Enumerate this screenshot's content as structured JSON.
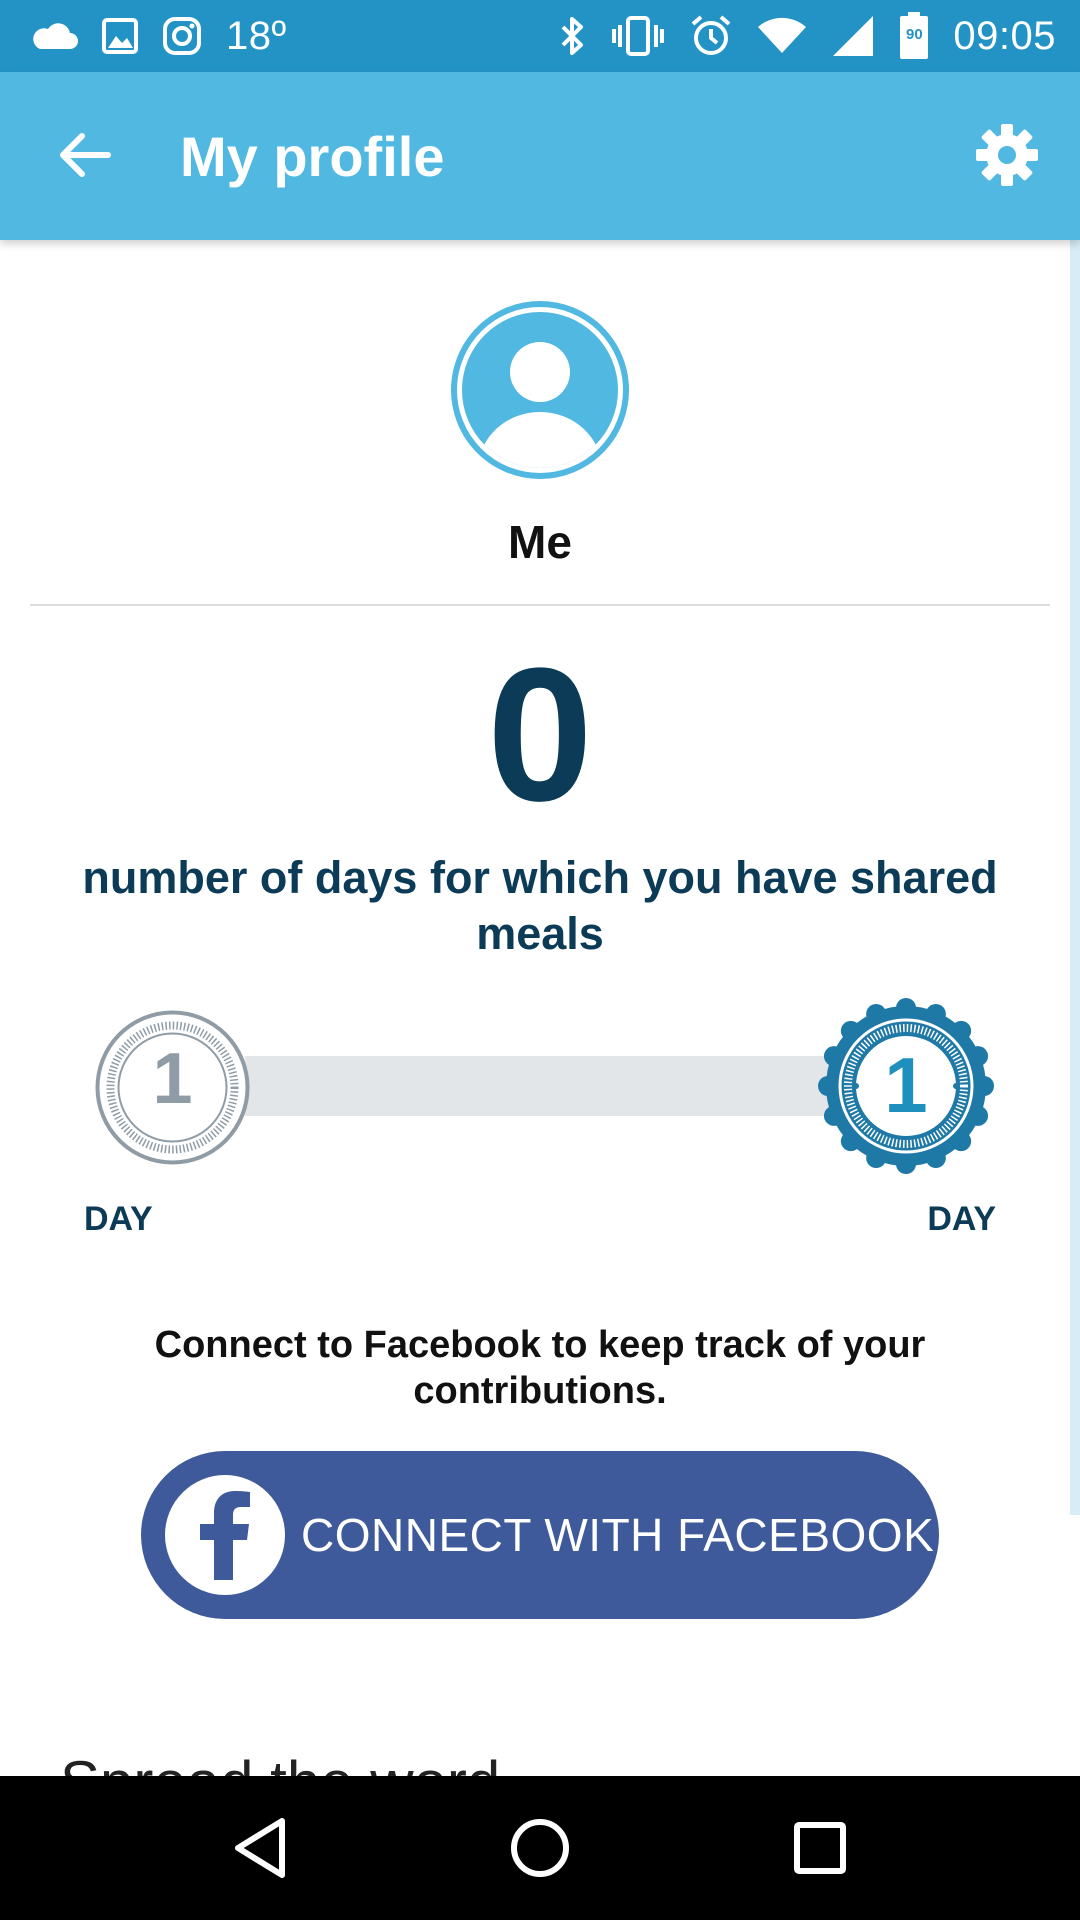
{
  "status_bar": {
    "temperature": "18º",
    "battery_level": "90",
    "time": "09:05",
    "icons": [
      "cloud-icon",
      "image-icon",
      "instagram-icon",
      "bluetooth-icon",
      "vibrate-icon",
      "alarm-icon",
      "wifi-icon",
      "signal-icon",
      "battery-icon"
    ]
  },
  "app_bar": {
    "title": "My profile",
    "back_icon": "arrow-left-icon",
    "settings_icon": "gear-icon"
  },
  "profile": {
    "name": "Me",
    "avatar_icon": "user-avatar-icon"
  },
  "stats": {
    "days_count": "0",
    "caption": "number of days for which you have shared meals"
  },
  "progress": {
    "start_value": "1",
    "start_label": "DAY",
    "end_value": "1",
    "end_label": "DAY"
  },
  "connect": {
    "text": "Connect to Facebook to keep track of your contributions.",
    "button_label": "CONNECT WITH FACEBOOK",
    "button_icon": "facebook-icon"
  },
  "share": {
    "title": "Spread the word"
  },
  "nav_bar": {
    "icons": [
      "back-triangle-icon",
      "home-circle-icon",
      "recents-square-icon"
    ]
  },
  "colors": {
    "status_bar": "#2393c5",
    "app_bar": "#51b8e1",
    "primary_text": "#0b3b57",
    "facebook": "#3f5a9a",
    "medal_inactive": "#8f9ca6",
    "medal_active": "#1f79a6"
  }
}
